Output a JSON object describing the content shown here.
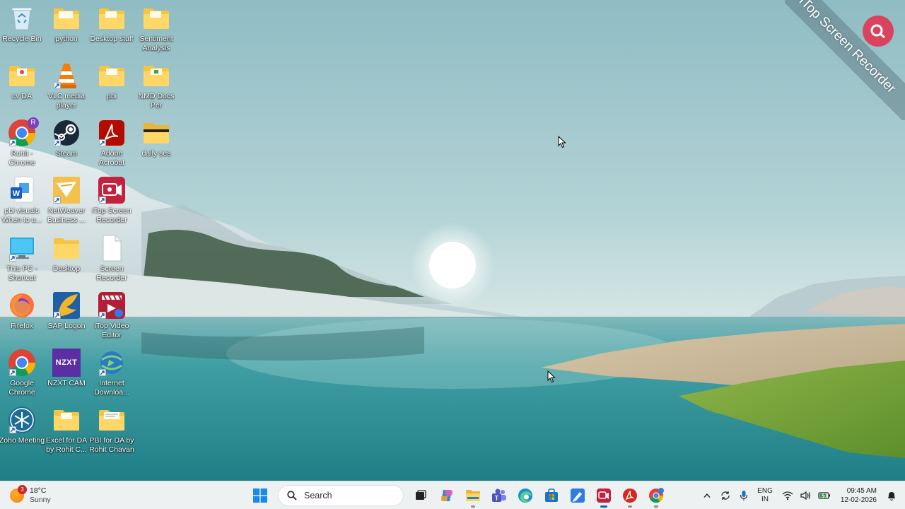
{
  "desktop": {
    "icons": [
      {
        "label": "Recycle Bin",
        "icon": "recycle-bin-icon"
      },
      {
        "label": "python",
        "icon": "folder-icon"
      },
      {
        "label": "Desktop stuff",
        "icon": "folder-icon"
      },
      {
        "label": "Sentiment Analysis",
        "icon": "folder-icon"
      },
      {
        "label": "cv DA",
        "icon": "folder-icon"
      },
      {
        "label": "VLC media player",
        "icon": "vlc-icon"
      },
      {
        "label": "pbi",
        "icon": "folder-icon"
      },
      {
        "label": "NMD Docs Per",
        "icon": "folder-icon"
      },
      {
        "label": "Rohit - Chrome",
        "icon": "chrome-profile-icon"
      },
      {
        "label": "Steam",
        "icon": "steam-icon"
      },
      {
        "label": "Adobe Acrobat",
        "icon": "acrobat-icon"
      },
      {
        "label": "daily ses",
        "icon": "folder-icon"
      },
      {
        "label": "pbi visuals When to u...",
        "icon": "word-doc-icon"
      },
      {
        "label": "NetWeaver Business ...",
        "icon": "netweaver-icon"
      },
      {
        "label": "iTop Screen Recorder",
        "icon": "itop-recorder-icon"
      },
      {
        "label": "This PC - Shortcut",
        "icon": "this-pc-icon"
      },
      {
        "label": "Desktop",
        "icon": "folder-icon"
      },
      {
        "label": "Screen Recorder",
        "icon": "file-icon"
      },
      {
        "label": "Firefox",
        "icon": "firefox-icon"
      },
      {
        "label": "SAP Logon",
        "icon": "sap-logon-icon"
      },
      {
        "label": "iTop Video Editor",
        "icon": "itop-video-editor-icon"
      },
      {
        "label": "Google Chrome",
        "icon": "chrome-icon"
      },
      {
        "label": "NZXT CAM",
        "icon": "nzxt-cam-icon"
      },
      {
        "label": "Internet Downloa...",
        "icon": "idm-icon"
      },
      {
        "label": "Zoho Meeting",
        "icon": "zoho-meeting-icon"
      },
      {
        "label": "Excel for DA by Rohit C...",
        "icon": "folder-icon"
      },
      {
        "label": "PBI for DA by Rohit Chavan",
        "icon": "folder-icon"
      }
    ],
    "profile_badge": "R",
    "nzxt_text": "NZXT"
  },
  "watermark": {
    "text": "iTop Screen Recorder"
  },
  "taskbar": {
    "weather": {
      "temp": "18°C",
      "condition": "Sunny",
      "badge": "3"
    },
    "search_placeholder": "Search",
    "apps": [
      {
        "name": "start",
        "icon": "windows-logo-icon"
      },
      {
        "name": "task-view",
        "icon": "task-view-icon"
      },
      {
        "name": "copilot",
        "icon": "copilot-icon"
      },
      {
        "name": "file-explorer",
        "icon": "folder-icon"
      },
      {
        "name": "teams",
        "icon": "teams-icon"
      },
      {
        "name": "edge",
        "icon": "edge-icon"
      },
      {
        "name": "store",
        "icon": "store-icon"
      },
      {
        "name": "app-launcher",
        "icon": "launcher-icon"
      },
      {
        "name": "itop-screen-recorder",
        "icon": "itop-recorder-icon"
      },
      {
        "name": "acrobat",
        "icon": "acrobat-icon"
      },
      {
        "name": "chrome",
        "icon": "chrome-icon"
      }
    ],
    "tray": {
      "lang_line1": "ENG",
      "lang_line2": "IN",
      "time": "09:45 AM",
      "date": "12-02-2026"
    }
  }
}
